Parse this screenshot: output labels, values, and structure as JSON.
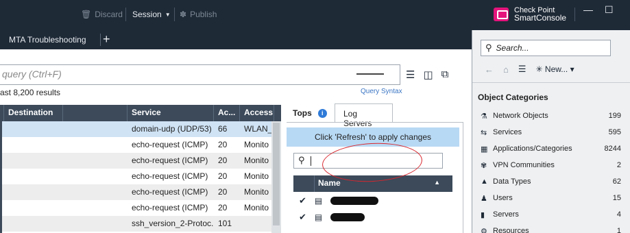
{
  "toolbar": {
    "discard_label": "Discard",
    "session_label": "Session",
    "publish_label": "Publish"
  },
  "brand": {
    "line1": "Check Point",
    "line2": "SmartConsole"
  },
  "tabs": [
    {
      "label": "MTA Troubleshooting"
    }
  ],
  "query": {
    "placeholder": "query (Ctrl+F)",
    "results": "ast 8,200 results",
    "syntax_link": "Query Syntax"
  },
  "log_table": {
    "headers": [
      "Destination",
      "Service",
      "Ac...",
      "Access"
    ],
    "rows": [
      {
        "service": "domain-udp (UDP/53)",
        "ac": "66",
        "access": "WLAN_V"
      },
      {
        "service": "echo-request (ICMP)",
        "ac": "20",
        "access": "Monito"
      },
      {
        "service": "echo-request (ICMP)",
        "ac": "20",
        "access": "Monito"
      },
      {
        "service": "echo-request (ICMP)",
        "ac": "20",
        "access": "Monito"
      },
      {
        "service": "echo-request (ICMP)",
        "ac": "20",
        "access": "Monito"
      },
      {
        "service": "echo-request (ICMP)",
        "ac": "20",
        "access": "Monito"
      },
      {
        "service": "ssh_version_2-Protoc...",
        "ac": "101",
        "access": ""
      }
    ]
  },
  "right_panel": {
    "tops_label": "Tops",
    "log_servers_tab": "Log Servers",
    "refresh_message": "Click 'Refresh' to apply changes",
    "name_header": "Name"
  },
  "sidebar": {
    "search_placeholder": "Search...",
    "new_label": "New...",
    "title": "Object Categories",
    "categories": [
      {
        "label": "Network Objects",
        "count": "199"
      },
      {
        "label": "Services",
        "count": "595"
      },
      {
        "label": "Applications/Categories",
        "count": "8244"
      },
      {
        "label": "VPN Communities",
        "count": "2"
      },
      {
        "label": "Data Types",
        "count": "62"
      },
      {
        "label": "Users",
        "count": "15"
      },
      {
        "label": "Servers",
        "count": "4"
      },
      {
        "label": "Resources",
        "count": "1"
      }
    ]
  },
  "colors": {
    "topbar_bg": "#1f2a37",
    "table_header": "#3c4a5a",
    "refresh_bar": "#b8d9f4",
    "selected_row": "#cfe3f5",
    "annotation": "#d8262d"
  }
}
